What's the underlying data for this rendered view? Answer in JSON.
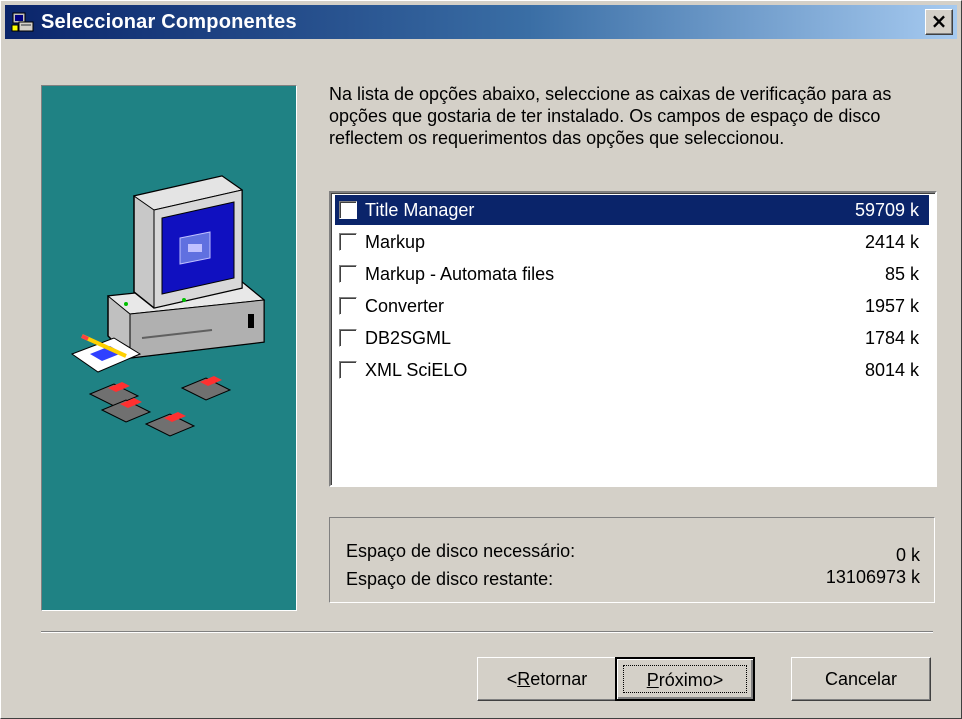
{
  "window": {
    "title": "Seleccionar Componentes",
    "close_glyph": "×"
  },
  "instructions": "Na lista de opções abaixo, seleccione as caixas de verificação para as opções que gostaria de ter instalado. Os campos de espaço de disco reflectem os requerimentos das opções que seleccionou.",
  "components": [
    {
      "name": "Title Manager",
      "size": "59709 k",
      "checked": false,
      "selected": true
    },
    {
      "name": "Markup",
      "size": "2414 k",
      "checked": false,
      "selected": false
    },
    {
      "name": "Markup - Automata files",
      "size": "85 k",
      "checked": false,
      "selected": false
    },
    {
      "name": "Converter",
      "size": "1957 k",
      "checked": false,
      "selected": false
    },
    {
      "name": "DB2SGML",
      "size": "1784 k",
      "checked": false,
      "selected": false
    },
    {
      "name": "XML SciELO",
      "size": "8014 k",
      "checked": false,
      "selected": false
    }
  ],
  "disk": {
    "required_label": "Espaço de disco necessário:",
    "required_value": "0 k",
    "remaining_label": "Espaço de disco restante:",
    "remaining_value": "13106973 k"
  },
  "buttons": {
    "back_prefix": "<",
    "back_accel": "R",
    "back_rest": "etornar",
    "next_accel": "P",
    "next_rest": "róximo>",
    "cancel": "Cancelar"
  },
  "icons": {
    "title": "installer-icon",
    "illustration": "computer-with-floppy-disks"
  }
}
